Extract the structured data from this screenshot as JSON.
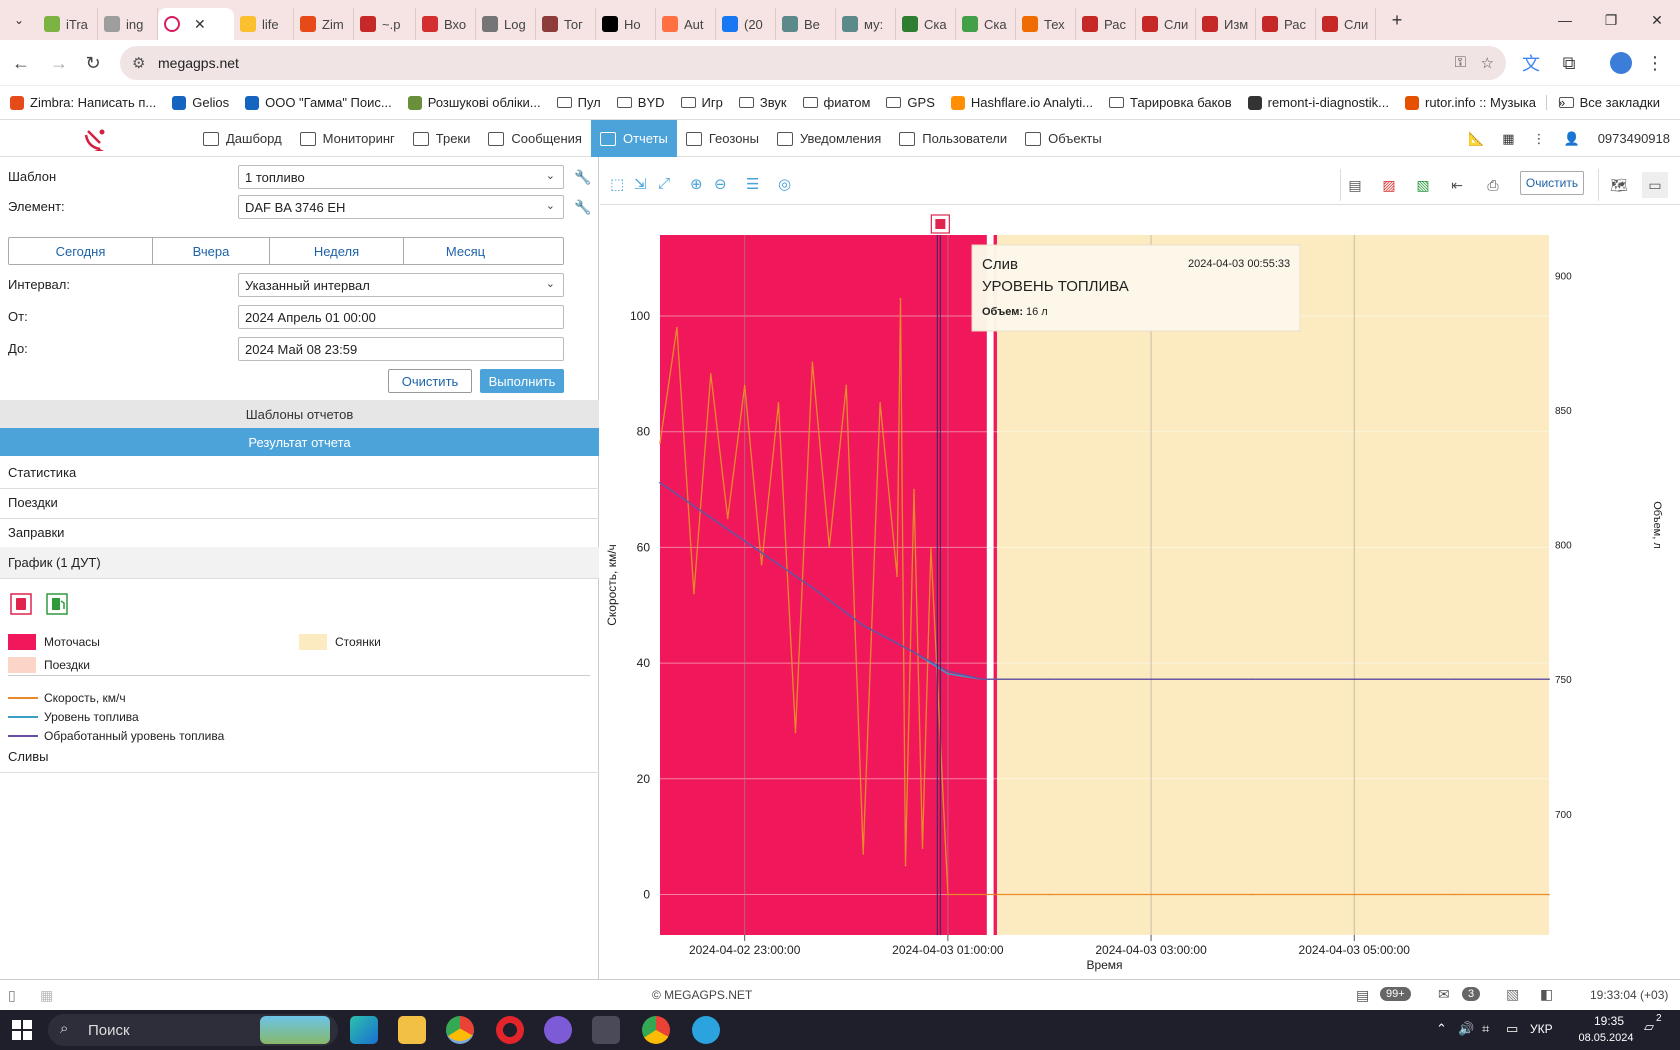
{
  "browser": {
    "tabs": [
      {
        "label": "iTra",
        "color": "#7cb342"
      },
      {
        "label": "ing",
        "color": "#9e9e9e"
      },
      {
        "label": "",
        "color": "#d81b60",
        "active": true
      },
      {
        "label": "life",
        "color": "#fbc02d"
      },
      {
        "label": "Zim",
        "color": "#e64a19"
      },
      {
        "label": "~.p",
        "color": "#c62828"
      },
      {
        "label": "Вхо",
        "color": "#d32f2f"
      },
      {
        "label": "Log",
        "color": "#757575"
      },
      {
        "label": "Тог",
        "color": "#8d3b3b"
      },
      {
        "label": "Ho",
        "color": "#000000"
      },
      {
        "label": "Aut",
        "color": "#ff7043"
      },
      {
        "label": "(20",
        "color": "#1877f2"
      },
      {
        "label": "Ве",
        "color": "#5c8a8a"
      },
      {
        "label": "му:",
        "color": "#5c8a8a"
      },
      {
        "label": "Ска",
        "color": "#2e7d32"
      },
      {
        "label": "Ска",
        "color": "#43a047"
      },
      {
        "label": "Тех",
        "color": "#ef6c00"
      },
      {
        "label": "Рас",
        "color": "#c62828"
      },
      {
        "label": "Сли",
        "color": "#c62828"
      },
      {
        "label": "Изм",
        "color": "#c62828"
      },
      {
        "label": "Рас",
        "color": "#c62828"
      },
      {
        "label": "Сли",
        "color": "#c62828"
      }
    ],
    "close_glyph": "✕",
    "new_tab": "+",
    "url": "megagps.net",
    "bookmarks": [
      {
        "label": "Zimbra: Написать п...",
        "color": "#e64a19"
      },
      {
        "label": "Gelios",
        "color": "#1565c0"
      },
      {
        "label": "ООО \"Гамма\" Поис...",
        "color": "#1565c0"
      },
      {
        "label": "Розшукові обліки...",
        "color": "#6a8f3a"
      },
      {
        "label": "Пул",
        "folder": true
      },
      {
        "label": "BYD",
        "folder": true
      },
      {
        "label": "Игр",
        "folder": true
      },
      {
        "label": "Звук",
        "folder": true
      },
      {
        "label": "фиатом",
        "folder": true
      },
      {
        "label": "GPS",
        "folder": true
      },
      {
        "label": "Hashflare.io Analyti...",
        "color": "#ff8f00"
      },
      {
        "label": "Тарировка баков",
        "folder": true
      },
      {
        "label": "remont-i-diagnostik...",
        "color": "#333333"
      },
      {
        "label": "rutor.info :: Музыка",
        "color": "#e65100"
      }
    ],
    "bookmarks_more": "»",
    "all_bookmarks": "Все закладки"
  },
  "app": {
    "menu": [
      {
        "label": "Дашборд"
      },
      {
        "label": "Мониторинг"
      },
      {
        "label": "Треки"
      },
      {
        "label": "Сообщения"
      },
      {
        "label": "Отчеты",
        "active": true
      },
      {
        "label": "Геозоны"
      },
      {
        "label": "Уведомления"
      },
      {
        "label": "Пользователи"
      },
      {
        "label": "Объекты"
      }
    ],
    "user_phone": "0973490918",
    "accent": "#4ba3d9"
  },
  "form": {
    "template_label": "Шаблон",
    "template_value": "1 топливо",
    "element_label": "Элемент:",
    "element_value": "DAF BA 3746 EH",
    "periods": [
      "Сегодня",
      "Вчера",
      "Неделя",
      "Месяц"
    ],
    "interval_label": "Интервал:",
    "interval_value": "Указанный интервал",
    "from_label": "От:",
    "from_value": "2024 Апрель 01 00:00",
    "to_label": "До:",
    "to_value": "2024 Май 08 23:59",
    "clear_btn": "Очистить",
    "run_btn": "Выполнить"
  },
  "report": {
    "templates_header": "Шаблоны отчетов",
    "result_header": "Результат отчета",
    "sections": [
      "Статистика",
      "Поездки",
      "Заправки",
      "График (1 ДУТ)"
    ],
    "legend_areas": [
      {
        "label": "Моточасы",
        "color": "#f0185a"
      },
      {
        "label": "Стоянки",
        "color": "#fcebc0"
      },
      {
        "label": "Поездки",
        "color": "#fdd5c8"
      }
    ],
    "legend_lines": [
      {
        "label": "Скорость, км/ч",
        "color": "#e88a2a"
      },
      {
        "label": "Уровень топлива",
        "color": "#3aa0c8"
      },
      {
        "label": "Обработанный уровень топлива",
        "color": "#6a4fa0"
      }
    ],
    "drains_section": "Сливы"
  },
  "chart_toolbar": {
    "clear_btn": "Очистить"
  },
  "chart_data": {
    "type": "line",
    "xlabel": "Время",
    "ylabel": "Скорость, км/ч",
    "y2label": "Объем, л",
    "ylim": [
      -7,
      114
    ],
    "y2lim": [
      655,
      915
    ],
    "xlim": [
      "2024-04-02 22:10:00",
      "2024-04-03 06:55:00"
    ],
    "x_ticks": [
      "2024-04-02 23:00:00",
      "2024-04-03 01:00:00",
      "2024-04-03 03:00:00",
      "2024-04-03 05:00:00"
    ],
    "y_ticks": [
      0,
      20,
      40,
      60,
      80,
      100
    ],
    "y2_ticks": [
      700,
      750,
      800,
      850,
      900
    ],
    "grid": true,
    "regions": [
      {
        "kind": "Моточасы",
        "from": "2024-04-02 22:10:00",
        "to": "2024-04-03 01:23:00",
        "color": "#f0185a"
      },
      {
        "kind": "Моточасы",
        "from": "2024-04-03 01:27:00",
        "to": "2024-04-03 01:29:00",
        "color": "#f0185a"
      },
      {
        "kind": "Стоянки",
        "from": "2024-04-03 01:29:00",
        "to": "2024-04-03 06:55:00",
        "color": "#fcebc0"
      }
    ],
    "series": [
      {
        "name": "Скорость, км/ч",
        "axis": "left",
        "color": "#e88a2a",
        "x": [
          "2024-04-02 22:10:00",
          "2024-04-02 22:20:00",
          "2024-04-02 22:30:00",
          "2024-04-02 22:40:00",
          "2024-04-02 22:50:00",
          "2024-04-02 23:00:00",
          "2024-04-02 23:10:00",
          "2024-04-02 23:20:00",
          "2024-04-02 23:30:00",
          "2024-04-02 23:40:00",
          "2024-04-02 23:50:00",
          "2024-04-03 00:00:00",
          "2024-04-03 00:10:00",
          "2024-04-03 00:20:00",
          "2024-04-03 00:30:00",
          "2024-04-03 00:32:00",
          "2024-04-03 00:35:00",
          "2024-04-03 00:40:00",
          "2024-04-03 00:45:00",
          "2024-04-03 00:50:00",
          "2024-04-03 01:00:00",
          "2024-04-03 02:00:00",
          "2024-04-03 03:00:00",
          "2024-04-03 04:00:00",
          "2024-04-03 05:00:00",
          "2024-04-03 06:00:00",
          "2024-04-03 06:55:00"
        ],
        "y": [
          78,
          98,
          52,
          90,
          65,
          88,
          57,
          85,
          28,
          92,
          60,
          88,
          7,
          85,
          55,
          103,
          5,
          70,
          8,
          60,
          0,
          0,
          0,
          0,
          0,
          0,
          0
        ]
      },
      {
        "name": "Уровень топлива",
        "axis": "right",
        "color": "#3aa0c8",
        "x": [
          "2024-04-02 22:10:00",
          "2024-04-02 22:40:00",
          "2024-04-02 23:10:00",
          "2024-04-02 23:40:00",
          "2024-04-03 00:10:00",
          "2024-04-03 00:40:00",
          "2024-04-03 01:00:00",
          "2024-04-03 01:20:00",
          "2024-04-03 02:00:00",
          "2024-04-03 03:00:00",
          "2024-04-03 04:00:00",
          "2024-04-03 05:00:00",
          "2024-04-03 06:00:00",
          "2024-04-03 06:55:00"
        ],
        "y": [
          823,
          810,
          797,
          784,
          770,
          760,
          752,
          750,
          750,
          750,
          750,
          750,
          750,
          750
        ]
      },
      {
        "name": "Обработанный уровень топлива",
        "axis": "right",
        "color": "#6a4fa0",
        "x": [
          "2024-04-02 22:10:00",
          "2024-04-02 22:40:00",
          "2024-04-02 23:10:00",
          "2024-04-02 23:40:00",
          "2024-04-03 00:10:00",
          "2024-04-03 00:40:00",
          "2024-04-03 01:00:00",
          "2024-04-03 01:20:00",
          "2024-04-03 02:00:00",
          "2024-04-03 03:00:00",
          "2024-04-03 04:00:00",
          "2024-04-03 05:00:00",
          "2024-04-03 06:00:00",
          "2024-04-03 06:55:00"
        ],
        "y": [
          823,
          810,
          797,
          784,
          770,
          760,
          753,
          750,
          750,
          750,
          750,
          750,
          750,
          750
        ]
      }
    ],
    "event_marker": {
      "time": "2024-04-03 00:55:33"
    },
    "tooltip": {
      "title": "Слив",
      "subtitle": "УРОВЕНЬ ТОПЛИВА",
      "time": "2024-04-03 00:55:33",
      "volume_label": "Объем:",
      "volume_value": "16 л"
    }
  },
  "status": {
    "copyright": "© MEGAGPS.NET",
    "badge_msgs": "99+",
    "badge_mail": "3",
    "clock": "19:33:04 (+03)"
  },
  "taskbar": {
    "search": "Поиск",
    "lang": "УКР",
    "time": "19:35",
    "date": "08.05.2024",
    "notif": "2"
  }
}
